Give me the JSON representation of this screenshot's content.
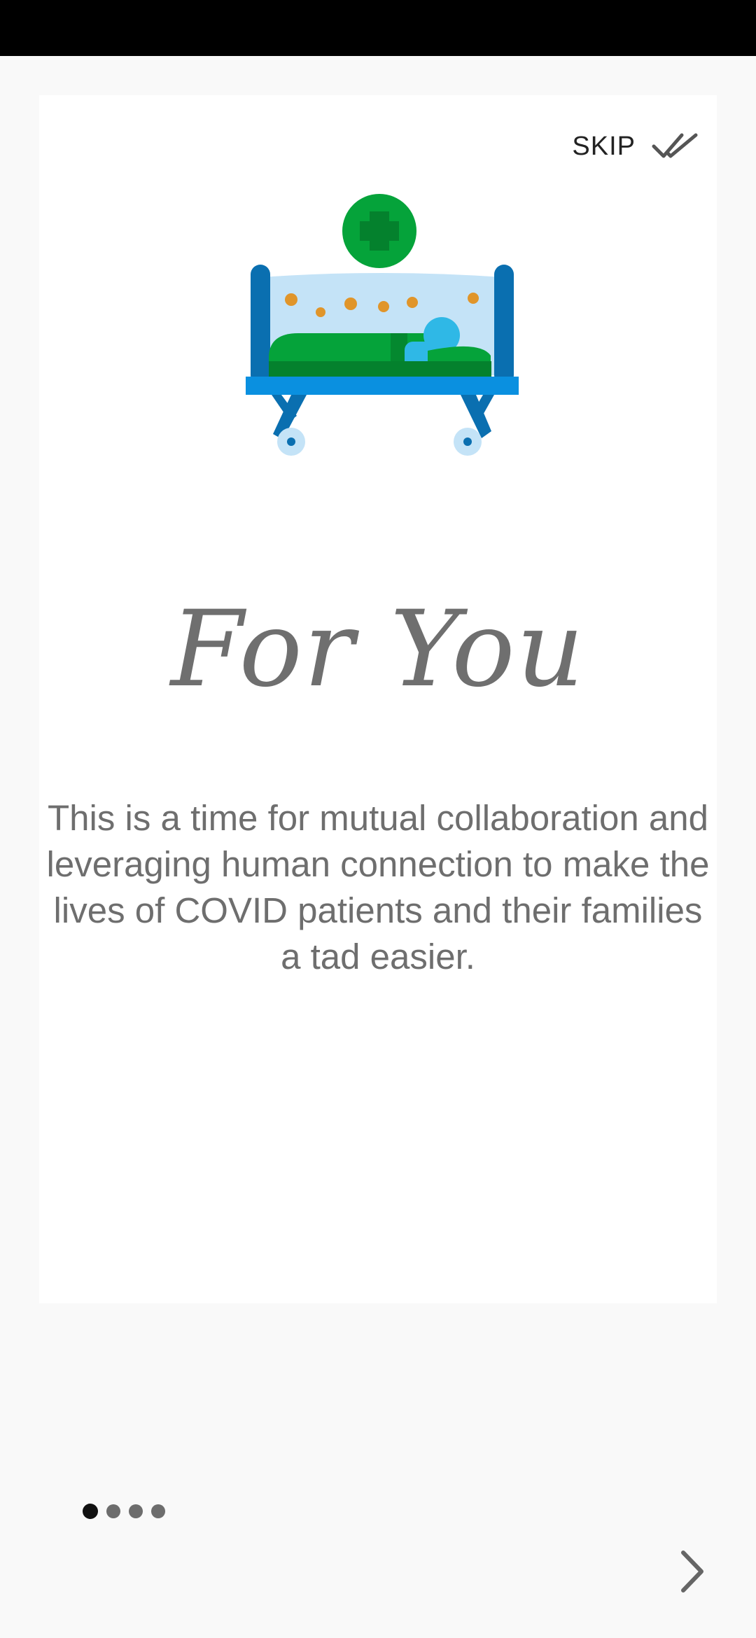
{
  "header": {
    "skip_label": "SKIP",
    "skip_icon": "double-check-icon"
  },
  "onboarding": {
    "illustration": "hospital-bed-patient-illustration",
    "title": "For You",
    "description": "This is a time for mutual collaboration and leveraging human connection to make the lives of COVID patients and their families a tad easier.",
    "current_page": 1,
    "total_pages": 4
  },
  "footer": {
    "next_icon": "chevron-right-icon"
  },
  "colors": {
    "green": "#05a33a",
    "dark_green": "#04812d",
    "blue_frame": "#0a6fb0",
    "light_blue": "#c4e3f7",
    "bed_blue": "#0a90e0",
    "patient_blue": "#2fb8e6",
    "orange_dot": "#e0952a",
    "text_gray": "#6e6e6e"
  }
}
